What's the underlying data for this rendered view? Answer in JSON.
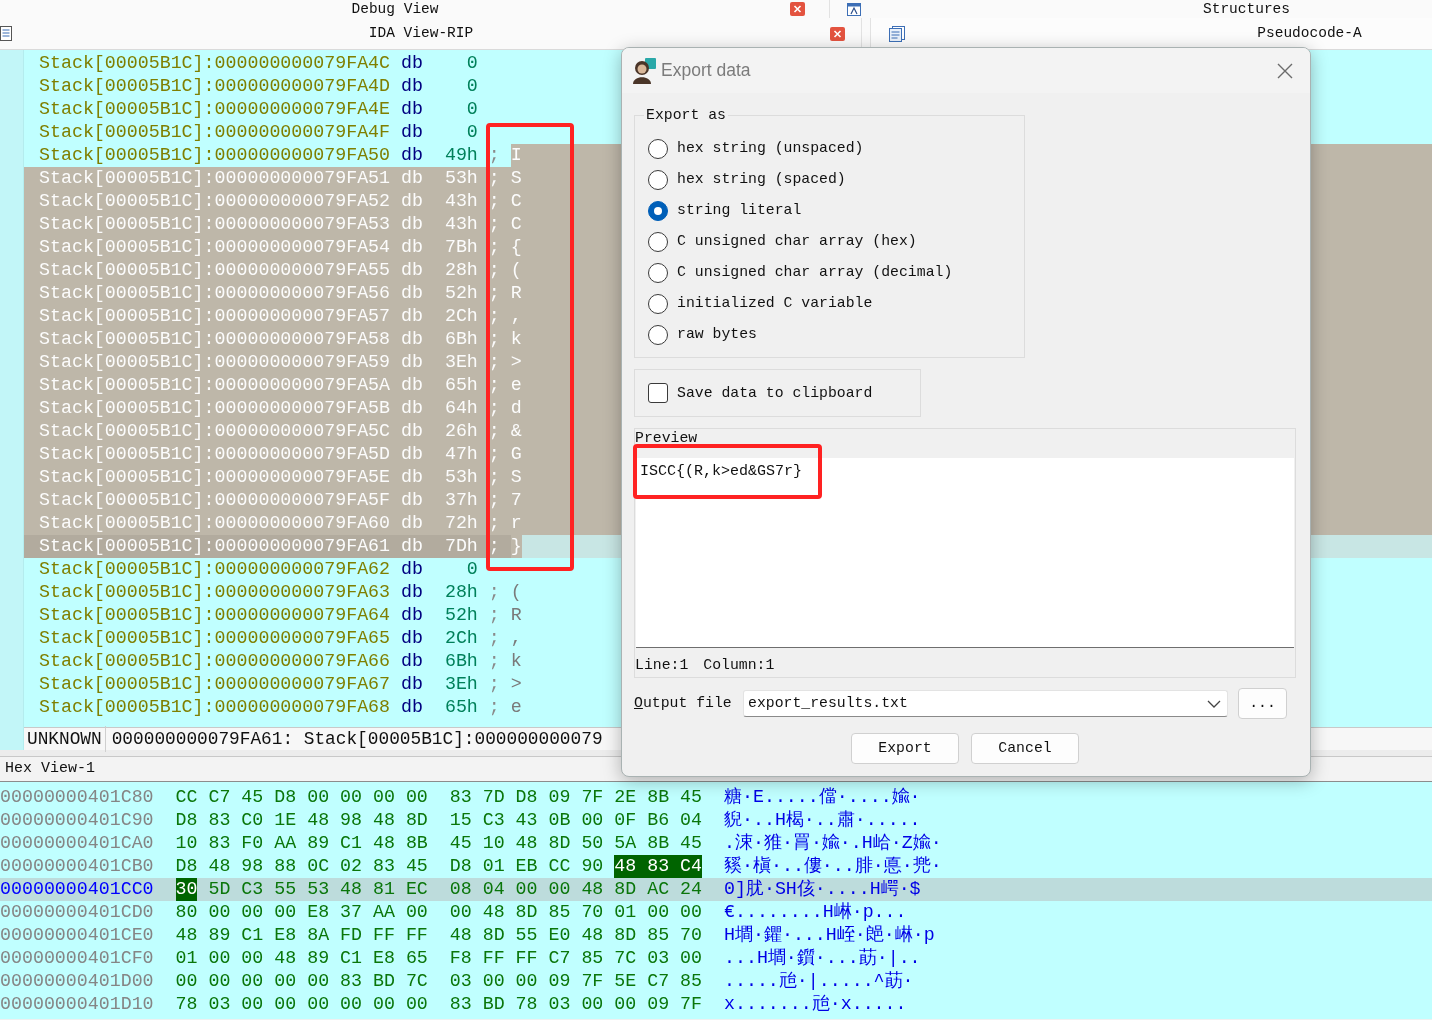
{
  "caption_rows": [
    {
      "captions": [
        {
          "title": "Debug View",
          "kind": "plain",
          "closable": true
        },
        {
          "title": "Structures",
          "kind": "frame",
          "closable": false
        }
      ]
    },
    {
      "captions": [
        {
          "title": "IDA View-RIP",
          "kind": "list",
          "closable": true
        },
        {
          "title": "Pseudocode-A",
          "kind": "doc",
          "closable": false
        }
      ]
    }
  ],
  "listing": {
    "outlined": true,
    "rows": [
      {
        "address": "Stack[00005B1C]:000000000079FA4C",
        "directive": "db",
        "value": "0",
        "selected": false,
        "current": false
      },
      {
        "address": "Stack[00005B1C]:000000000079FA4D",
        "directive": "db",
        "value": "0",
        "selected": false,
        "current": false
      },
      {
        "address": "Stack[00005B1C]:000000000079FA4E",
        "directive": "db",
        "value": "0",
        "selected": false,
        "current": false
      },
      {
        "address": "Stack[00005B1C]:000000000079FA4F",
        "directive": "db",
        "value": "0",
        "selected": false,
        "current": false
      },
      {
        "address": "Stack[00005B1C]:000000000079FA50",
        "directive": "db",
        "value": "49h",
        "marker": ";",
        "comment": "I",
        "comment_selected": true,
        "selected": false,
        "current": false
      },
      {
        "address": "Stack[00005B1C]:000000000079FA51",
        "directive": "db",
        "value": "53h",
        "marker": ";",
        "comment": "S",
        "comment_selected": true,
        "selected": true,
        "current": false
      },
      {
        "address": "Stack[00005B1C]:000000000079FA52",
        "directive": "db",
        "value": "43h",
        "marker": ";",
        "comment": "C",
        "comment_selected": true,
        "selected": true,
        "current": false
      },
      {
        "address": "Stack[00005B1C]:000000000079FA53",
        "directive": "db",
        "value": "43h",
        "marker": ";",
        "comment": "C",
        "comment_selected": true,
        "selected": true,
        "current": false
      },
      {
        "address": "Stack[00005B1C]:000000000079FA54",
        "directive": "db",
        "value": "7Bh",
        "marker": ";",
        "comment": "{",
        "comment_selected": true,
        "selected": true,
        "current": false
      },
      {
        "address": "Stack[00005B1C]:000000000079FA55",
        "directive": "db",
        "value": "28h",
        "marker": ";",
        "comment": "(",
        "comment_selected": true,
        "selected": true,
        "current": false
      },
      {
        "address": "Stack[00005B1C]:000000000079FA56",
        "directive": "db",
        "value": "52h",
        "marker": ";",
        "comment": "R",
        "comment_selected": true,
        "selected": true,
        "current": false
      },
      {
        "address": "Stack[00005B1C]:000000000079FA57",
        "directive": "db",
        "value": "2Ch",
        "marker": ";",
        "comment": ",",
        "comment_selected": true,
        "selected": true,
        "current": false
      },
      {
        "address": "Stack[00005B1C]:000000000079FA58",
        "directive": "db",
        "value": "6Bh",
        "marker": ";",
        "comment": "k",
        "comment_selected": true,
        "selected": true,
        "current": false
      },
      {
        "address": "Stack[00005B1C]:000000000079FA59",
        "directive": "db",
        "value": "3Eh",
        "marker": ";",
        "comment": ">",
        "comment_selected": true,
        "selected": true,
        "current": false
      },
      {
        "address": "Stack[00005B1C]:000000000079FA5A",
        "directive": "db",
        "value": "65h",
        "marker": ";",
        "comment": "e",
        "comment_selected": true,
        "selected": true,
        "current": false
      },
      {
        "address": "Stack[00005B1C]:000000000079FA5B",
        "directive": "db",
        "value": "64h",
        "marker": ";",
        "comment": "d",
        "comment_selected": true,
        "selected": true,
        "current": false
      },
      {
        "address": "Stack[00005B1C]:000000000079FA5C",
        "directive": "db",
        "value": "26h",
        "marker": ";",
        "comment": "&",
        "comment_selected": true,
        "selected": true,
        "current": false
      },
      {
        "address": "Stack[00005B1C]:000000000079FA5D",
        "directive": "db",
        "value": "47h",
        "marker": ";",
        "comment": "G",
        "comment_selected": true,
        "selected": true,
        "current": false
      },
      {
        "address": "Stack[00005B1C]:000000000079FA5E",
        "directive": "db",
        "value": "53h",
        "marker": ";",
        "comment": "S",
        "comment_selected": true,
        "selected": true,
        "current": false
      },
      {
        "address": "Stack[00005B1C]:000000000079FA5F",
        "directive": "db",
        "value": "37h",
        "marker": ";",
        "comment": "7",
        "comment_selected": true,
        "selected": true,
        "current": false
      },
      {
        "address": "Stack[00005B1C]:000000000079FA60",
        "directive": "db",
        "value": "72h",
        "marker": ";",
        "comment": "r",
        "comment_selected": true,
        "selected": true,
        "current": false
      },
      {
        "address": "Stack[00005B1C]:000000000079FA61",
        "directive": "db",
        "value": "7Dh",
        "marker": ";",
        "comment": "}",
        "comment_selected": true,
        "selected": true,
        "current": true
      },
      {
        "address": "Stack[00005B1C]:000000000079FA62",
        "directive": "db",
        "value": "0",
        "selected": false,
        "current": false
      },
      {
        "address": "Stack[00005B1C]:000000000079FA63",
        "directive": "db",
        "value": "28h",
        "marker": ";",
        "comment": "(",
        "comment_selected": false,
        "selected": false,
        "current": false
      },
      {
        "address": "Stack[00005B1C]:000000000079FA64",
        "directive": "db",
        "value": "52h",
        "marker": ";",
        "comment": "R",
        "comment_selected": false,
        "selected": false,
        "current": false
      },
      {
        "address": "Stack[00005B1C]:000000000079FA65",
        "directive": "db",
        "value": "2Ch",
        "marker": ";",
        "comment": ",",
        "comment_selected": false,
        "selected": false,
        "current": false
      },
      {
        "address": "Stack[00005B1C]:000000000079FA66",
        "directive": "db",
        "value": "6Bh",
        "marker": ";",
        "comment": "k",
        "comment_selected": false,
        "selected": false,
        "current": false
      },
      {
        "address": "Stack[00005B1C]:000000000079FA67",
        "directive": "db",
        "value": "3Eh",
        "marker": ";",
        "comment": ">",
        "comment_selected": false,
        "selected": false,
        "current": false
      },
      {
        "address": "Stack[00005B1C]:000000000079FA68",
        "directive": "db",
        "value": "65h",
        "marker": ";",
        "comment": "e",
        "comment_selected": false,
        "selected": false,
        "current": false
      }
    ],
    "status": {
      "mode": "UNKNOWN",
      "text": "000000000079FA61: Stack[00005B1C]:000000000079"
    }
  },
  "hex_view": {
    "title": "Hex View-1",
    "rows": [
      {
        "address": "00000000401C80",
        "current": false,
        "runs": [
          {
            "bytes": [
              "CC",
              "C7",
              "45",
              "D8",
              "00",
              "00",
              "00",
              "00",
              "83",
              "7D",
              "D8",
              "09",
              "7F",
              "2E",
              "8B",
              "45"
            ],
            "selected": false
          }
        ],
        "text": "糖·E.....儅·....婾·"
      },
      {
        "address": "00000000401C90",
        "current": false,
        "runs": [
          {
            "bytes": [
              "D8",
              "83",
              "C0",
              "1E",
              "48",
              "98",
              "48",
              "8D",
              "15",
              "C3",
              "43",
              "0B",
              "00",
              "0F",
              "B6",
              "04"
            ],
            "selected": false
          }
        ],
        "text": "貎·..H楬·..肅·....."
      },
      {
        "address": "00000000401CA0",
        "current": false,
        "runs": [
          {
            "bytes": [
              "10",
              "83",
              "F0",
              "AA",
              "89",
              "C1",
              "48",
              "8B",
              "45",
              "10",
              "48",
              "8D",
              "50",
              "5A",
              "8B",
              "45"
            ],
            "selected": false
          }
        ],
        "text": ".涑·猚·罥·婾·.H峆·Z婾·"
      },
      {
        "address": "00000000401CB0",
        "current": false,
        "runs": [
          {
            "bytes": [
              "D8",
              "48",
              "98",
              "88",
              "0C",
              "02",
              "83",
              "45",
              "D8",
              "01",
              "EB",
              "CC",
              "90"
            ],
            "selected": false
          },
          {
            "bytes": [
              "48",
              "83",
              "C4"
            ],
            "selected": true
          }
        ],
        "text": "豯·槇·..僂·..腓·悳·兠·"
      },
      {
        "address": "00000000401CC0",
        "current": true,
        "runs": [
          {
            "bytes": [
              "30"
            ],
            "selected": true
          },
          {
            "bytes": [
              "5D",
              "C3",
              "55",
              "53",
              "48",
              "81",
              "EC",
              "08",
              "04",
              "00",
              "00",
              "48",
              "8D",
              "AC",
              "24"
            ],
            "selected": false
          }
        ],
        "text": "0]肬·SH侅·....H崿·$"
      },
      {
        "address": "00000000401CD0",
        "current": false,
        "runs": [
          {
            "bytes": [
              "80",
              "00",
              "00",
              "00",
              "E8",
              "37",
              "AA",
              "00",
              "00",
              "48",
              "8D",
              "85",
              "70",
              "01",
              "00",
              "00"
            ],
            "selected": false
          }
        ],
        "text": "€........H崊·p..."
      },
      {
        "address": "00000000401CE0",
        "current": false,
        "runs": [
          {
            "bytes": [
              "48",
              "89",
              "C1",
              "E8",
              "8A",
              "FD",
              "FF",
              "FF",
              "48",
              "8D",
              "55",
              "E0",
              "48",
              "8D",
              "85",
              "70"
            ],
            "selected": false
          }
        ],
        "text": "H墹·鑺·...H峌·郒·崊·p"
      },
      {
        "address": "00000000401CF0",
        "current": false,
        "runs": [
          {
            "bytes": [
              "01",
              "00",
              "00",
              "48",
              "89",
              "C1",
              "E8",
              "65",
              "F8",
              "FF",
              "FF",
              "C7",
              "85",
              "7C",
              "03",
              "00"
            ],
            "selected": false
          }
        ],
        "text": "...H墹·鑕·...莇·|.."
      },
      {
        "address": "00000000401D00",
        "current": false,
        "runs": [
          {
            "bytes": [
              "00",
              "00",
              "00",
              "00",
              "00",
              "83",
              "BD",
              "7C",
              "03",
              "00",
              "00",
              "09",
              "7F",
              "5E",
              "C7",
              "85"
            ],
            "selected": false
          }
        ],
        "text": ".....兘·|.....^莇·"
      },
      {
        "address": "00000000401D10",
        "current": false,
        "runs": [
          {
            "bytes": [
              "78",
              "03",
              "00",
              "00",
              "00",
              "00",
              "00",
              "00",
              "83",
              "BD",
              "78",
              "03",
              "00",
              "00",
              "09",
              "7F"
            ],
            "selected": false
          }
        ],
        "text": "x.......兘·x....."
      }
    ]
  },
  "dialog": {
    "title": "Export data",
    "export_as": {
      "label": "Export as",
      "options": [
        {
          "label": "hex string (unspaced)",
          "selected": false
        },
        {
          "label": "hex string (spaced)",
          "selected": false
        },
        {
          "label": "string literal",
          "selected": true
        },
        {
          "label": "C unsigned char array (hex)",
          "selected": false
        },
        {
          "label": "C unsigned char array (decimal)",
          "selected": false
        },
        {
          "label": "initialized C variable",
          "selected": false
        },
        {
          "label": "raw bytes",
          "selected": false
        }
      ]
    },
    "clipboard": {
      "label": "Save data to clipboard",
      "checked": false
    },
    "preview": {
      "label": "Preview",
      "text": "ISCC{(R,k>ed&GS7r}",
      "outlined": true,
      "line": "Line:1",
      "column": "Column:1"
    },
    "output_file": {
      "label": "Output file",
      "mnemonic": true,
      "value": "export_results.txt"
    },
    "browse_button": "...",
    "buttons": [
      {
        "label": "Export"
      },
      {
        "label": "Cancel"
      }
    ]
  }
}
